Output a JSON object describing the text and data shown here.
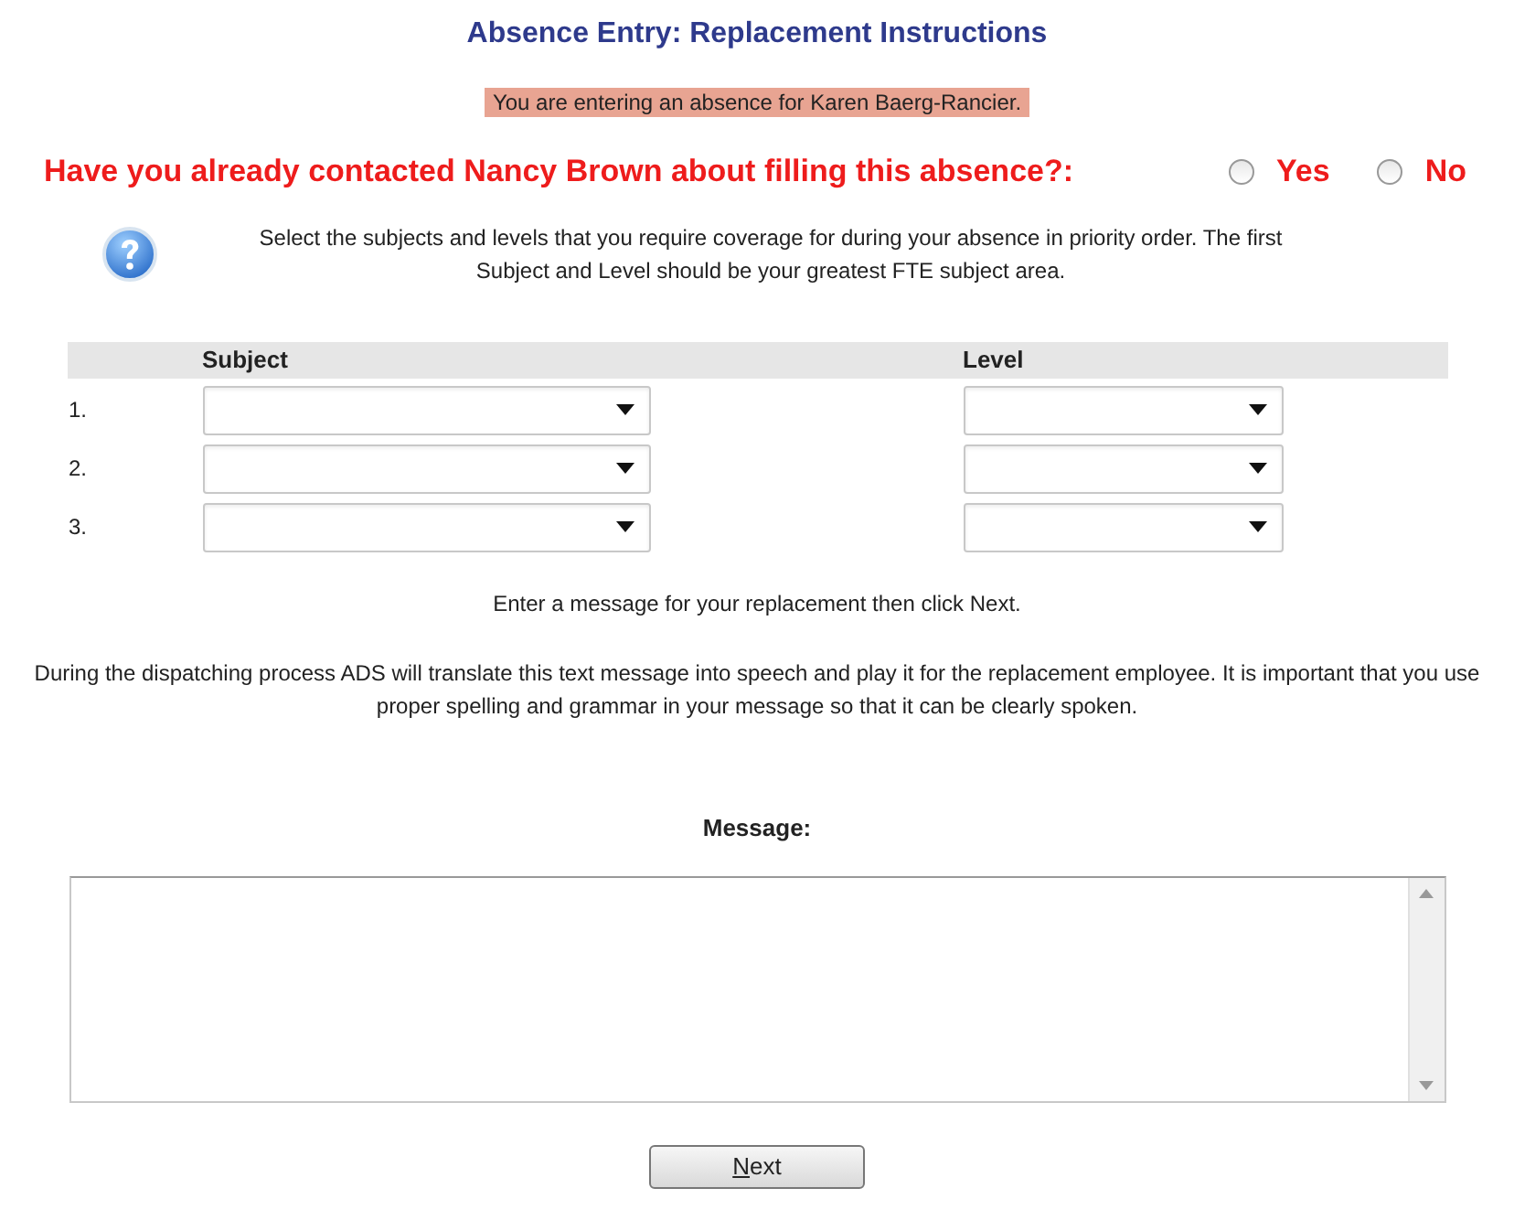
{
  "title": "Absence Entry: Replacement Instructions",
  "banner": "You are entering an absence for Karen Baerg-Rancier.",
  "question": {
    "label": "Have you already contacted Nancy Brown about filling this absence?:",
    "options": [
      {
        "label": "Yes",
        "selected": false
      },
      {
        "label": "No",
        "selected": false
      }
    ]
  },
  "help_text": "Select the subjects and levels that you require coverage for during your absence in priority order. The first Subject and Level should be your greatest FTE subject area.",
  "table": {
    "columns": [
      "Subject",
      "Level"
    ],
    "rows": [
      {
        "label": "1."
      },
      {
        "label": "2."
      },
      {
        "label": "3."
      }
    ]
  },
  "instruction": "Enter a message for your replacement then click Next.",
  "note": "During the dispatching process ADS will translate this text message into speech and play it for the replacement employee. It is important that you use proper spelling and grammar in your message so that it can be clearly spoken.",
  "message_label": "Message:",
  "next_button": "Next"
}
